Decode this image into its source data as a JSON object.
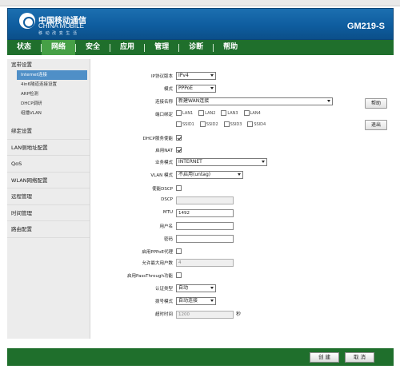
{
  "header": {
    "brand_cn": "中国移动通信",
    "brand_en": "CHINA MOBILE",
    "slogan": "移 动 改 变 生 活",
    "model": "GM219-S"
  },
  "nav": {
    "items": [
      {
        "label": "状态"
      },
      {
        "label": "网络"
      },
      {
        "label": "安全"
      },
      {
        "label": "应用"
      },
      {
        "label": "管理"
      },
      {
        "label": "诊断"
      },
      {
        "label": "帮助"
      }
    ],
    "active_index": 1
  },
  "sidebar": {
    "group_broadband": "宽带设置",
    "sub_items": [
      "Internet连接",
      "4in6隧道连接设置",
      "ARP检测",
      "DHCP调研",
      "组播VLAN"
    ],
    "groups": [
      "绑定设置",
      "LAN侧地址配置",
      "QoS",
      "WLAN网络配置",
      "远程管理",
      "时间管理",
      "路由配置"
    ]
  },
  "form": {
    "ip_version": {
      "label": "IP协议版本",
      "value": "IPv4"
    },
    "mode": {
      "label": "模式",
      "value": "PPPoE"
    },
    "connection_name": {
      "label": "连接名称",
      "value": "新建WAN连接"
    },
    "port_binding": {
      "label": "端口绑定",
      "lan_ports": [
        "LAN1",
        "LAN2",
        "LAN3",
        "LAN4"
      ],
      "ssid_ports": [
        "SSID1",
        "SSID2",
        "SSID3",
        "SSID4"
      ]
    },
    "dhcp_service": {
      "label": "DHCP服务使能",
      "checked": true
    },
    "enable_nat": {
      "label": "启用NAT",
      "checked": true
    },
    "service_mode": {
      "label": "业务模式",
      "value": "INTERNET"
    },
    "vlan_mode": {
      "label": "VLAN 模式",
      "value": "不启用(untag)"
    },
    "enable_dscp": {
      "label": "使能DSCP",
      "checked": false
    },
    "dscp": {
      "label": "DSCP",
      "value": ""
    },
    "mtu": {
      "label": "MTU",
      "value": "1492"
    },
    "username": {
      "label": "用户名",
      "value": ""
    },
    "password": {
      "label": "密码",
      "value": ""
    },
    "pppoe_proxy": {
      "label": "启用PPPoE代理",
      "checked": false
    },
    "max_users": {
      "label": "允许最大用户数",
      "value": "4"
    },
    "passthrough": {
      "label": "启用PassThrough功能",
      "checked": false
    },
    "auth_type": {
      "label": "认证类型",
      "value": "自动"
    },
    "dial_mode": {
      "label": "拨号模式",
      "value": "自动连接"
    },
    "timeout": {
      "label": "超时时间",
      "value": "1200",
      "unit": "秒"
    }
  },
  "buttons": {
    "help": "帮助",
    "logout": "退出",
    "create": "创 建",
    "cancel": "取 消"
  }
}
